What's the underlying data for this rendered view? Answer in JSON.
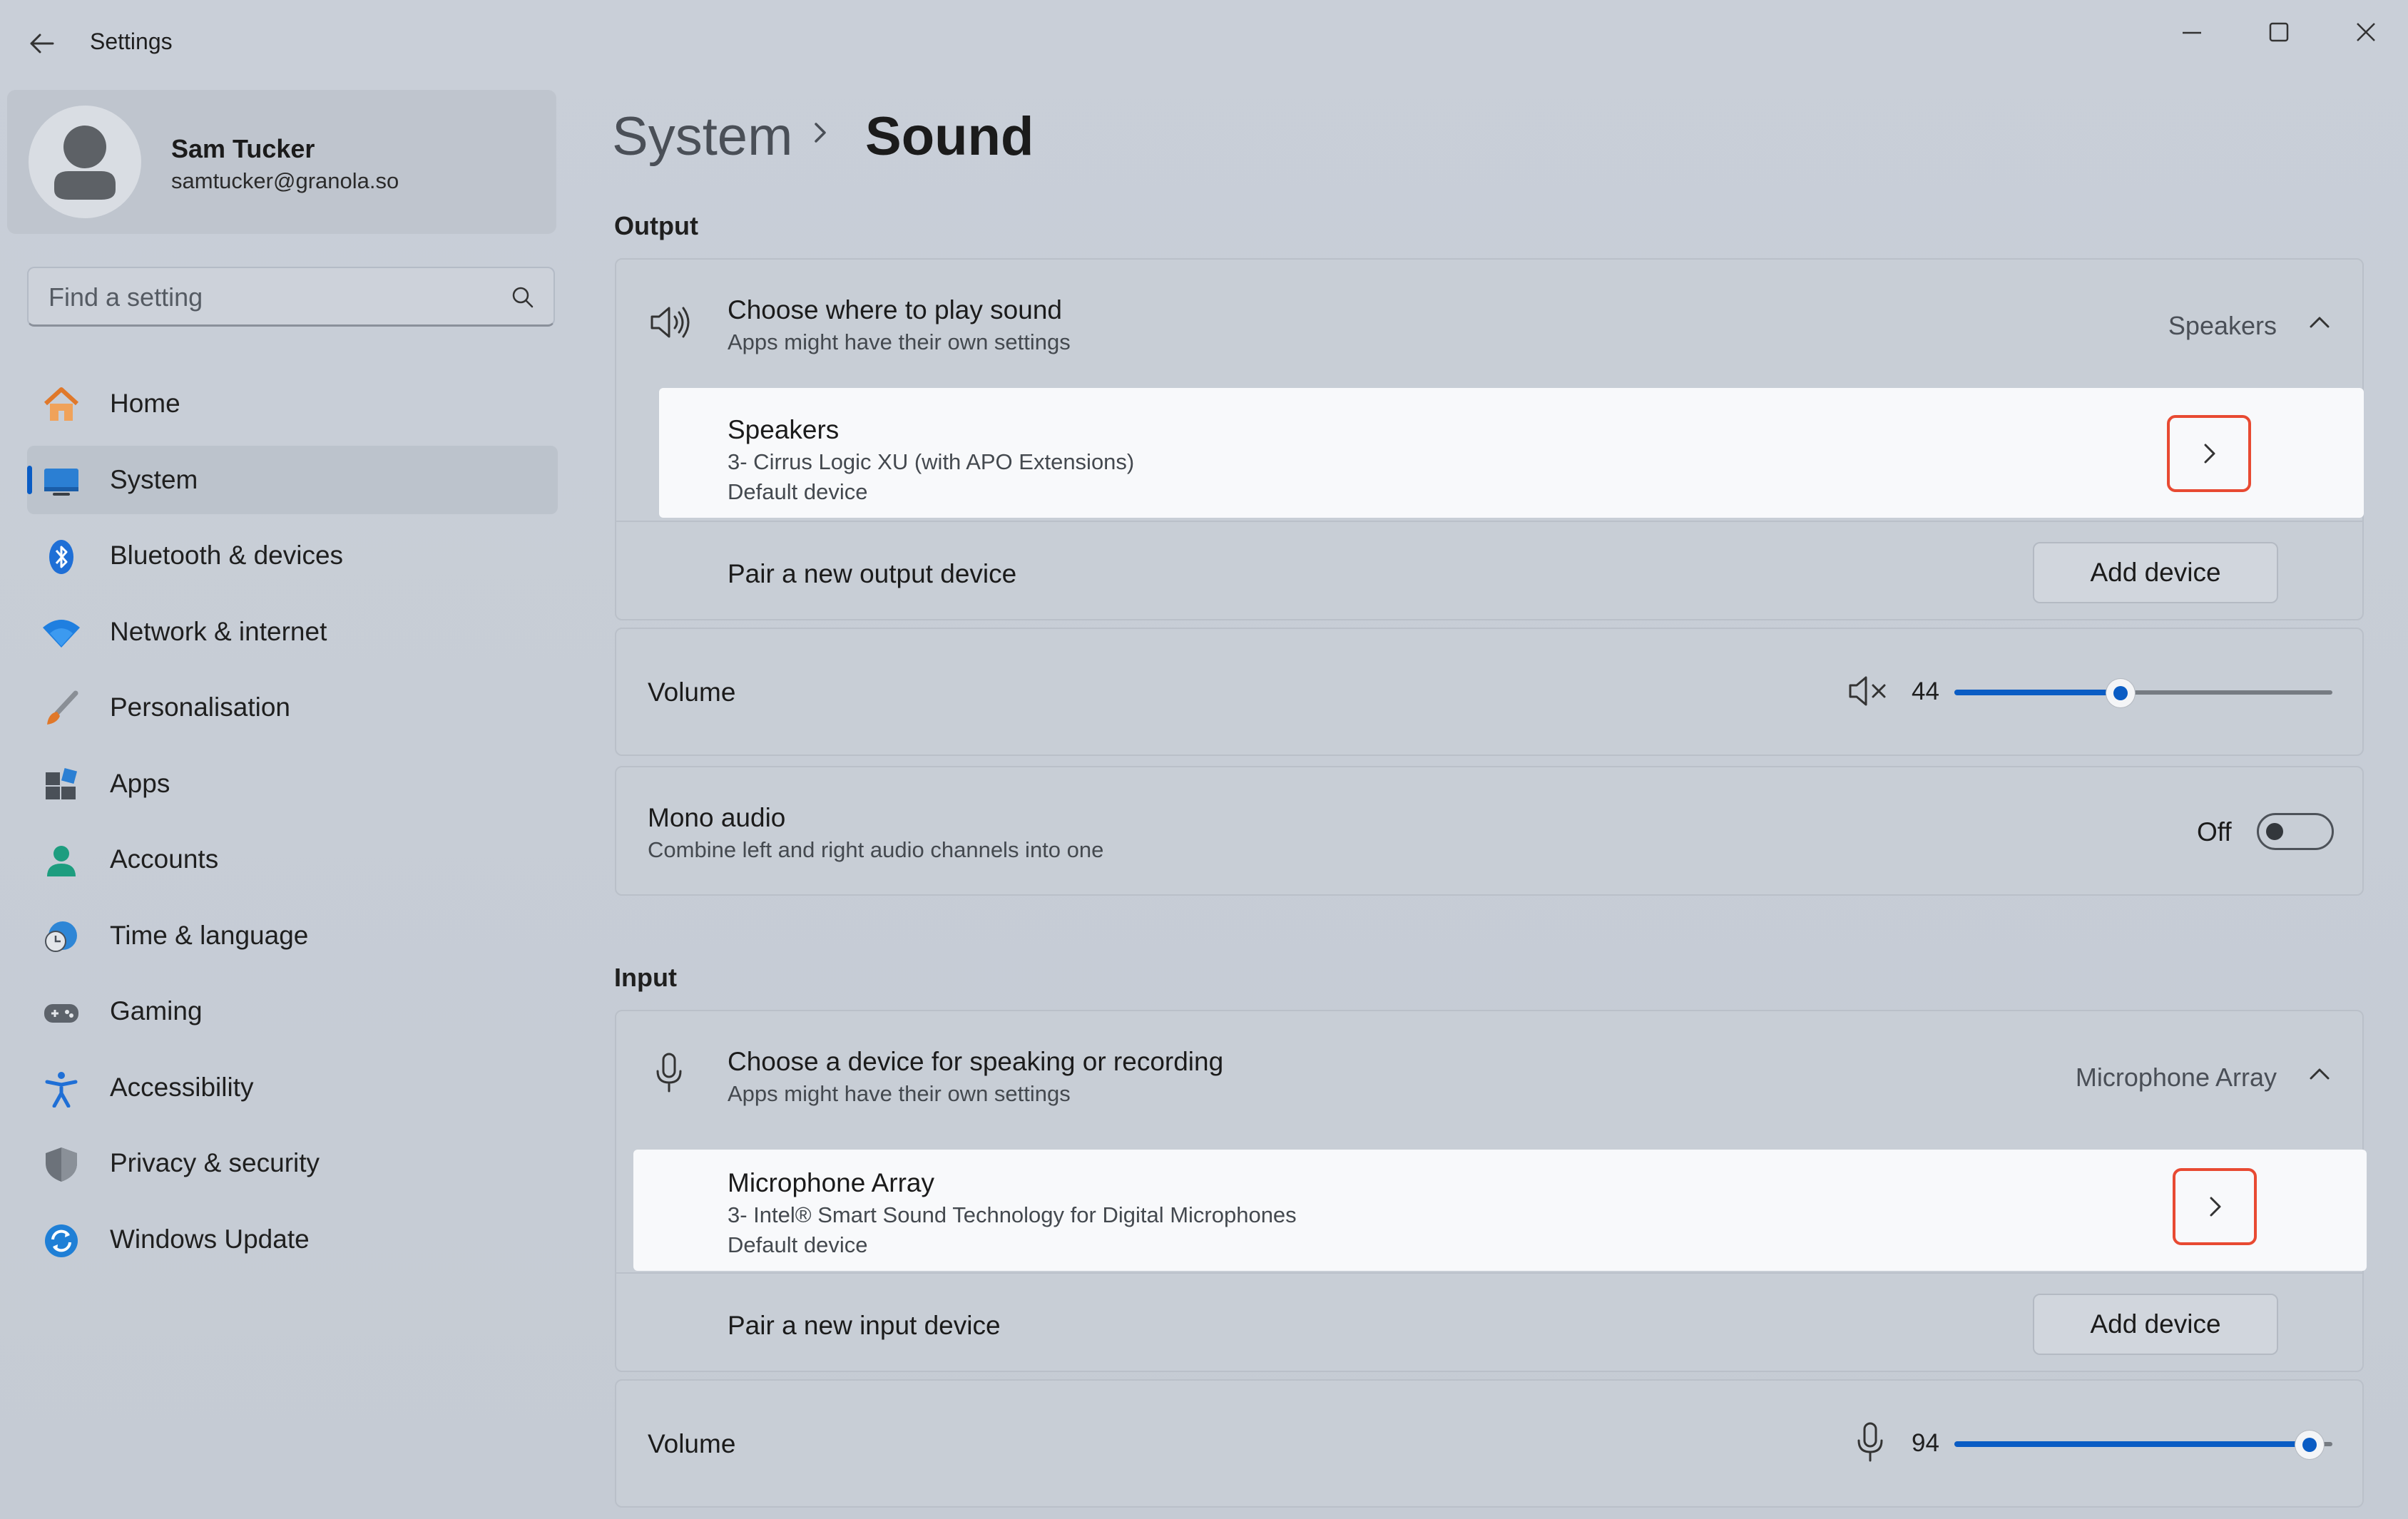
{
  "window": {
    "title": "Settings"
  },
  "profile": {
    "name": "Sam Tucker",
    "email": "samtucker@granola.so"
  },
  "search": {
    "placeholder": "Find a setting"
  },
  "nav": {
    "items": [
      {
        "label": "Home",
        "icon": "home-icon"
      },
      {
        "label": "System",
        "icon": "system-icon",
        "active": true
      },
      {
        "label": "Bluetooth & devices",
        "icon": "bluetooth-icon"
      },
      {
        "label": "Network & internet",
        "icon": "wifi-icon"
      },
      {
        "label": "Personalisation",
        "icon": "brush-icon"
      },
      {
        "label": "Apps",
        "icon": "apps-icon"
      },
      {
        "label": "Accounts",
        "icon": "accounts-icon"
      },
      {
        "label": "Time & language",
        "icon": "time-language-icon"
      },
      {
        "label": "Gaming",
        "icon": "gaming-icon"
      },
      {
        "label": "Accessibility",
        "icon": "accessibility-icon"
      },
      {
        "label": "Privacy & security",
        "icon": "shield-icon"
      },
      {
        "label": "Windows Update",
        "icon": "update-icon"
      }
    ]
  },
  "breadcrumb": {
    "parent": "System",
    "current": "Sound"
  },
  "output": {
    "section_title": "Output",
    "choose_title": "Choose where to play sound",
    "choose_sub": "Apps might have their own settings",
    "selected": "Speakers",
    "device": {
      "name": "Speakers",
      "detail": "3- Cirrus Logic XU (with APO Extensions)",
      "status": "Default device"
    },
    "pair_label": "Pair a new output device",
    "add_button": "Add device",
    "volume_label": "Volume",
    "volume_value": "44",
    "mono_title": "Mono audio",
    "mono_sub": "Combine left and right audio channels into one",
    "mono_state": "Off"
  },
  "input": {
    "section_title": "Input",
    "choose_title": "Choose a device for speaking or recording",
    "choose_sub": "Apps might have their own settings",
    "selected": "Microphone Array",
    "device": {
      "name": "Microphone Array",
      "detail": "3- Intel® Smart Sound Technology for Digital Microphones",
      "status": "Default device"
    },
    "pair_label": "Pair a new input device",
    "add_button": "Add device",
    "volume_label": "Volume",
    "volume_value": "94"
  },
  "colors": {
    "accent": "#0a5cc4",
    "highlight_border": "#e84a32"
  }
}
